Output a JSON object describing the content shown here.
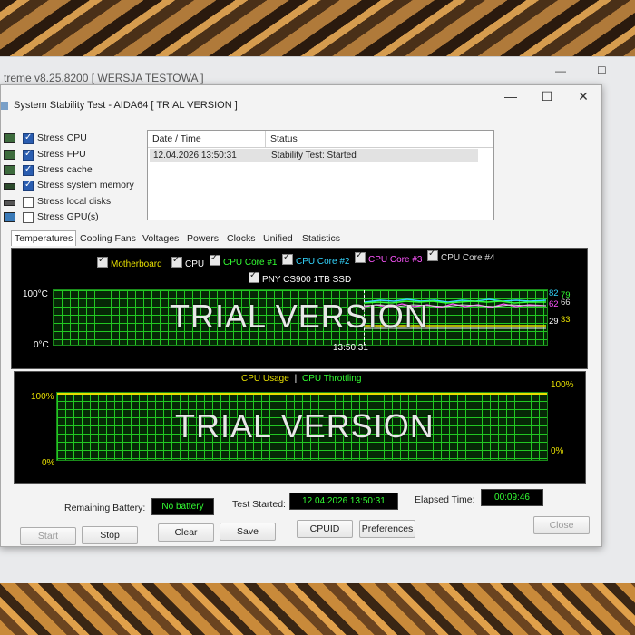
{
  "bg_window": {
    "title": "treme v8.25.8200  [ WERSJA TESTOWA ]",
    "minimize_glyph": "—",
    "maximize_glyph": "☐"
  },
  "window": {
    "title": "System Stability Test - AIDA64  [ TRIAL VERSION ]",
    "minimize_glyph": "—",
    "maximize_glyph": "☐",
    "close_glyph": "✕"
  },
  "stress_options": [
    {
      "label": "Stress CPU",
      "checked": true,
      "icon": "cpu-icon"
    },
    {
      "label": "Stress FPU",
      "checked": true,
      "icon": "fpu-icon"
    },
    {
      "label": "Stress cache",
      "checked": true,
      "icon": "cache-icon"
    },
    {
      "label": "Stress system memory",
      "checked": true,
      "icon": "memory-icon"
    },
    {
      "label": "Stress local disks",
      "checked": false,
      "icon": "disk-icon"
    },
    {
      "label": "Stress GPU(s)",
      "checked": false,
      "icon": "gpu-icon"
    }
  ],
  "log": {
    "headers": [
      "Date / Time",
      "Status"
    ],
    "rows": [
      {
        "datetime": "12.04.2026 13:50:31",
        "status": "Stability Test: Started"
      }
    ]
  },
  "tabs": [
    "Temperatures",
    "Cooling Fans",
    "Voltages",
    "Powers",
    "Clocks",
    "Unified",
    "Statistics"
  ],
  "temp_chart": {
    "legend": [
      {
        "label": "Motherboard",
        "color": "#e8e000"
      },
      {
        "label": "CPU",
        "color": "#ffffff"
      },
      {
        "label": "CPU Core #1",
        "color": "#33ff33"
      },
      {
        "label": "CPU Core #2",
        "color": "#33d6ff"
      },
      {
        "label": "CPU Core #3",
        "color": "#ff55ff"
      },
      {
        "label": "CPU Core #4",
        "color": "#dcdcdc"
      },
      {
        "label": "PNY CS900 1TB SSD",
        "color": "#ffffff"
      }
    ],
    "y_top": "100°C",
    "y_bottom": "0°C",
    "x_time": "13:50:31",
    "watermark": "TRIAL VERSION",
    "readouts": [
      {
        "text": "82",
        "color": "#33d6ff"
      },
      {
        "text": "79",
        "color": "#33ff33"
      },
      {
        "text": "62",
        "color": "#ff55ff"
      },
      {
        "text": "66",
        "color": "#dcdcdc"
      },
      {
        "text": "29",
        "color": "#ffffff"
      },
      {
        "text": "33",
        "color": "#e8e000"
      }
    ]
  },
  "usage_chart": {
    "legend_usage": "CPU Usage",
    "legend_sep": "|",
    "legend_throttle": "CPU Throttling",
    "usage_color": "#e8e000",
    "throttle_color": "#33ff33",
    "y_top_left": "100%",
    "y_bottom_left": "0%",
    "y_top_right": "100%",
    "y_bottom_right": "0%",
    "watermark": "TRIAL VERSION"
  },
  "status_bar": {
    "battery_label": "Remaining Battery:",
    "battery_value": "No battery",
    "started_label": "Test Started:",
    "started_value": "12.04.2026 13:50:31",
    "elapsed_label": "Elapsed Time:",
    "elapsed_value": "00:09:46"
  },
  "buttons": {
    "start": "Start",
    "stop": "Stop",
    "clear": "Clear",
    "save": "Save",
    "cpuid": "CPUID",
    "preferences": "Preferences",
    "close": "Close"
  }
}
